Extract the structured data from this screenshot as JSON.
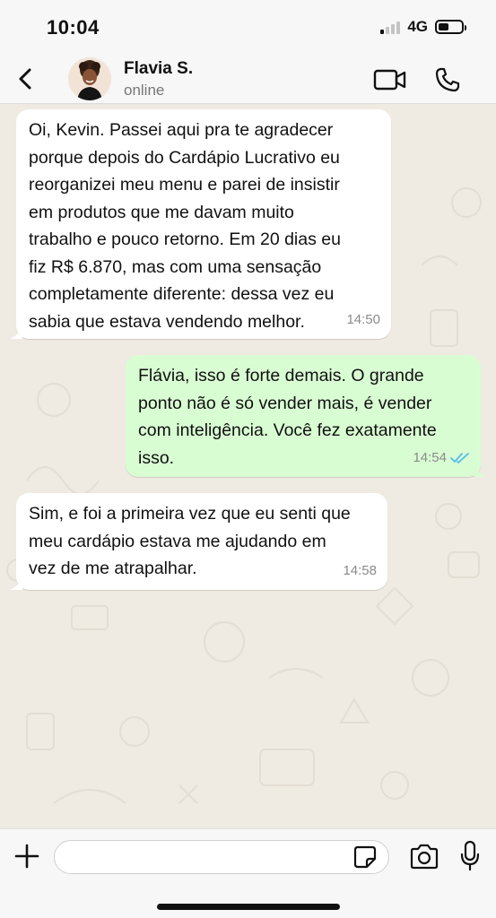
{
  "status_bar": {
    "time": "10:04",
    "network": "4G",
    "signal_icon": "signal-bars-icon",
    "battery_icon": "battery-icon",
    "battery_level": 0.45
  },
  "header": {
    "contact_name": "Flavia S.",
    "contact_status": "online",
    "icons": {
      "back": "chevron-left-icon",
      "video": "video-camera-icon",
      "call": "phone-icon"
    }
  },
  "messages": [
    {
      "direction": "incoming",
      "text": "Oi, Kevin. Passei aqui pra te agradecer\nporque depois do Cardápio Lucrativo eu\nreorganizei meu menu e parei de insistir\nem produtos que me davam muito\ntrabalho e pouco retorno. Em 20 dias eu\nfiz R$ 6.870, mas com uma sensação\ncompletamente diferente: dessa vez eu\nsabia que estava vendendo melhor.",
      "time": "14:50"
    },
    {
      "direction": "outgoing",
      "text": "Flávia, isso é forte demais. O grande\nponto não é só vender mais, é vender\ncom inteligência. Você fez exatamente\nisso.",
      "time": "14:54",
      "read_icon": "double-check-icon"
    },
    {
      "direction": "incoming",
      "text": "Sim, e foi a primeira vez que eu senti que\nmeu cardápio estava me ajudando em\nvez de me atrapalhar.",
      "time": "14:58"
    }
  ],
  "input_bar": {
    "placeholder": "",
    "value": "",
    "icons": {
      "attach": "plus-icon",
      "sticker": "sticker-icon",
      "camera": "camera-icon",
      "mic": "microphone-icon"
    }
  },
  "colors": {
    "incoming_bubble": "#ffffff",
    "outgoing_bubble": "#d9fdd3",
    "read_check": "#53bdeb",
    "chat_background": "#efeae2"
  }
}
